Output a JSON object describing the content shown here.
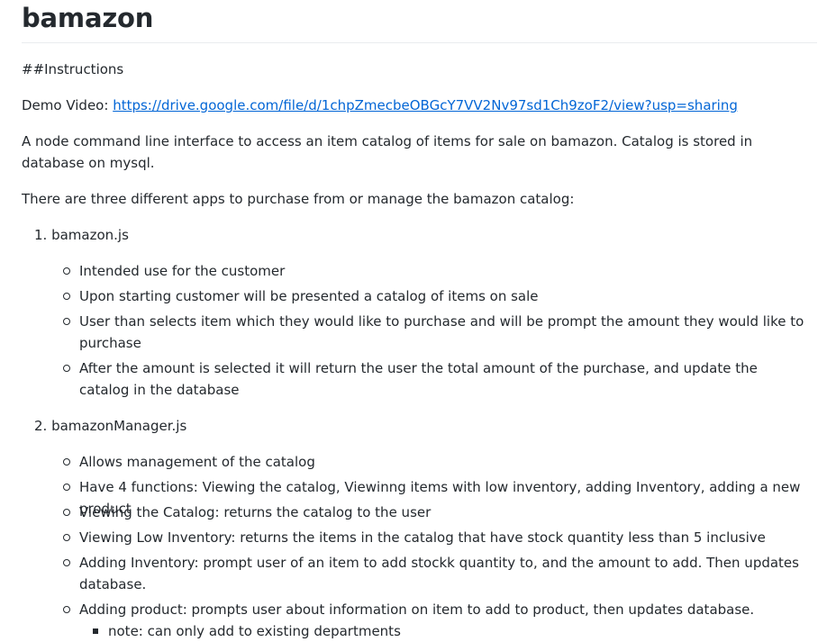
{
  "readme": {
    "title": "bamazon",
    "instructions_heading": "##Instructions",
    "demo_label": "Demo Video: ",
    "demo_link": "https://drive.google.com/file/d/1chpZmecbeOBGcY7VV2Nv97sd1Ch9zoF2/view?usp=sharing",
    "intro": "A node command line interface to access an item catalog of items for sale on bamazon. Catalog is stored in database on mysql.",
    "apps_intro": "There are three different apps to purchase from or manage the bamazon catalog:",
    "apps": [
      {
        "number": "1.",
        "name": "bamazon.js",
        "items": [
          "Intended use for the customer",
          "Upon starting customer will be presented a catalog of items on sale",
          "User than selects item which they would like to purchase and will be prompt the amount they would like to purchase",
          "After the amount is selected it will return the user the total amount of the purchase, and update the catalog in the database"
        ]
      },
      {
        "number": "2.",
        "name": "bamazonManager.js",
        "items": [
          "Allows management of the catalog",
          "Have 4 functions: Viewing the catalog, Viewinng items with low inventory, adding Inventory, adding a new product",
          "Viewing the Catalog: returns the catalog to the user",
          "Viewing Low Inventory: returns the items in the catalog that have stock quantity less than 5 inclusive",
          "Adding Inventory: prompt user of an item to add stockk quantity to, and the amount to add. Then updates database.",
          "Adding product: prompts user about information on item to add to product, then updates database."
        ],
        "subitems": [
          "note: can only add to existing departments"
        ]
      }
    ]
  }
}
